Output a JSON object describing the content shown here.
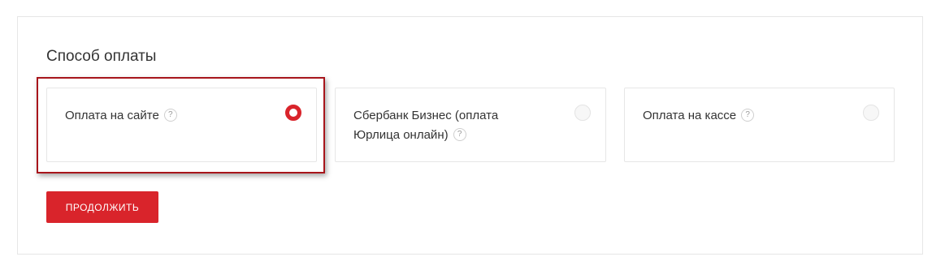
{
  "payment": {
    "title": "Способ оплаты",
    "options": [
      {
        "label": "Оплата на сайте",
        "help": "?",
        "selected": true
      },
      {
        "label": "Сбербанк Бизнес (оплата Юрлица онлайн)",
        "help": "?",
        "selected": false
      },
      {
        "label": "Оплата на кассе",
        "help": "?",
        "selected": false
      }
    ],
    "continue_label": "ПРОДОЛЖИТЬ"
  },
  "colors": {
    "accent": "#d9242b",
    "highlight_border": "#a7151b",
    "border": "#e6e6e6"
  }
}
